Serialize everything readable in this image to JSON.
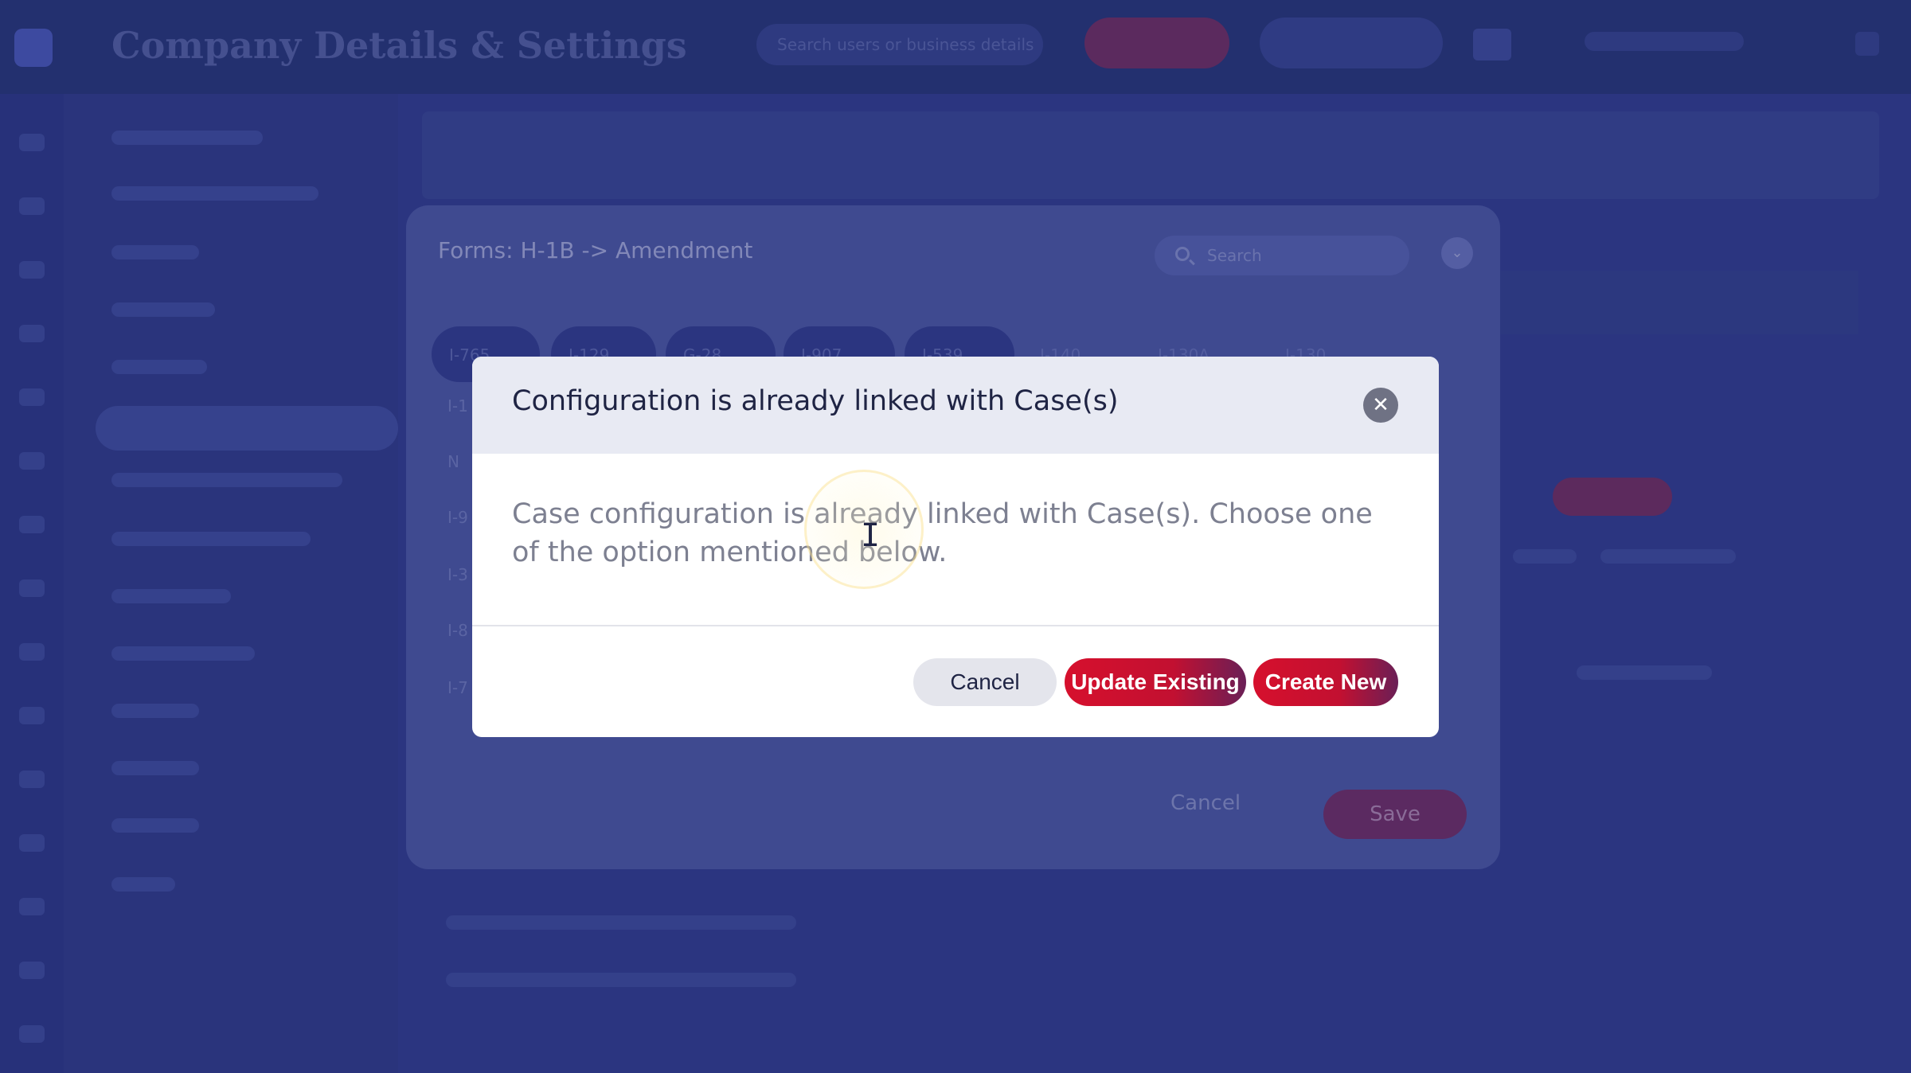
{
  "app": {
    "title": "Company Details & Settings",
    "search_placeholder": "Search users or business details"
  },
  "forms_dialog": {
    "title": "Forms: H-1B -> Amendment",
    "search_placeholder": "Search",
    "tabs": [
      "I-765",
      "I-129",
      "G-28",
      "I-907",
      "I-539"
    ],
    "tabs_plain": [
      "I-140",
      "I-130A",
      "I-130"
    ],
    "row_labels": [
      "I-1",
      "N",
      "I-9",
      "I-3",
      "I-8",
      "I-7"
    ],
    "cancel_label": "Cancel",
    "save_label": "Save"
  },
  "modal": {
    "title": "Configuration is already linked with Case(s)",
    "body": "Case configuration is already linked with Case(s). Choose one of the option mentioned below.",
    "buttons": {
      "cancel": "Cancel",
      "update_existing": "Update Existing",
      "create_new": "Create New"
    },
    "close_icon": "close-icon"
  },
  "colors": {
    "accent": "#d6102d",
    "overlay": "#1a2467",
    "modal_header": "#e8eaf3"
  }
}
